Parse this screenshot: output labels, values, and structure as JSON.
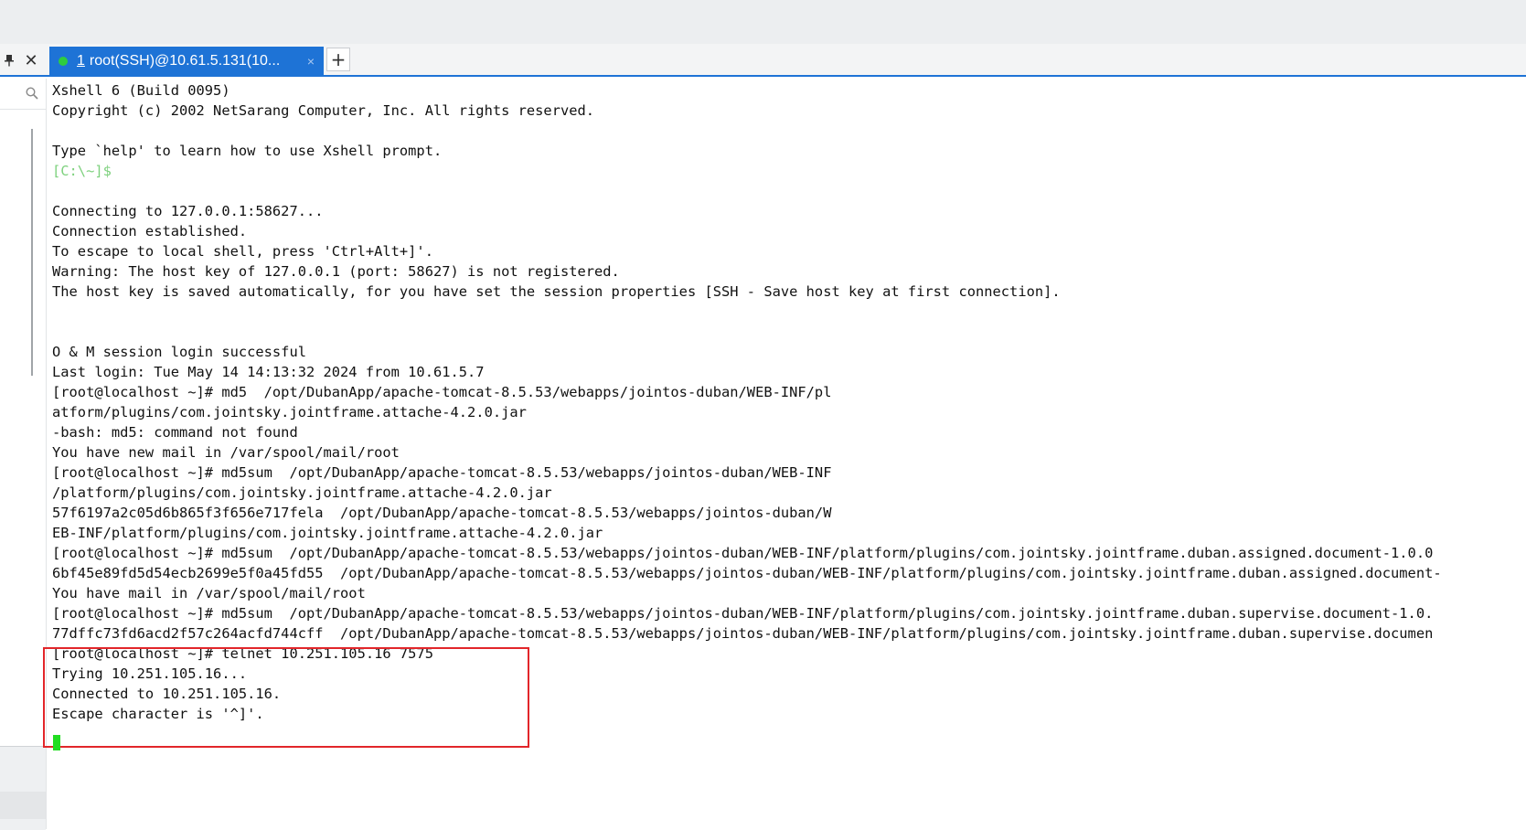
{
  "tabs": {
    "active": {
      "number": "1",
      "title": "root(SSH)@10.61.5.131(10...",
      "close_glyph": "×"
    },
    "new_tab_glyph": "+",
    "pin_glyph": "📌",
    "close_panel_glyph": "✕"
  },
  "terminal": {
    "lines": [
      {
        "text": "Xshell 6 (Build 0095)"
      },
      {
        "text": "Copyright (c) 2002 NetSarang Computer, Inc. All rights reserved."
      },
      {
        "text": ""
      },
      {
        "text": "Type `help' to learn how to use Xshell prompt."
      },
      {
        "text": "[C:\\~]$",
        "style": "local-prompt"
      },
      {
        "text": ""
      },
      {
        "text": "Connecting to 127.0.0.1:58627..."
      },
      {
        "text": "Connection established."
      },
      {
        "text": "To escape to local shell, press 'Ctrl+Alt+]'."
      },
      {
        "text": "Warning: The host key of 127.0.0.1 (port: 58627) is not registered."
      },
      {
        "text": "The host key is saved automatically, for you have set the session properties [SSH - Save host key at first connection]."
      },
      {
        "text": ""
      },
      {
        "text": ""
      },
      {
        "text": "O & M session login successful"
      },
      {
        "text": "Last login: Tue May 14 14:13:32 2024 from 10.61.5.7"
      },
      {
        "text": "[root@localhost ~]# md5  /opt/DubanApp/apache-tomcat-8.5.53/webapps/jointos-duban/WEB-INF/pl"
      },
      {
        "text": "atform/plugins/com.jointsky.jointframe.attache-4.2.0.jar"
      },
      {
        "text": "-bash: md5: command not found"
      },
      {
        "text": "You have new mail in /var/spool/mail/root"
      },
      {
        "text": "[root@localhost ~]# md5sum  /opt/DubanApp/apache-tomcat-8.5.53/webapps/jointos-duban/WEB-INF"
      },
      {
        "text": "/platform/plugins/com.jointsky.jointframe.attache-4.2.0.jar"
      },
      {
        "text": "57f6197a2c05d6b865f3f656e717fela  /opt/DubanApp/apache-tomcat-8.5.53/webapps/jointos-duban/W"
      },
      {
        "text": "EB-INF/platform/plugins/com.jointsky.jointframe.attache-4.2.0.jar"
      },
      {
        "text": "[root@localhost ~]# md5sum  /opt/DubanApp/apache-tomcat-8.5.53/webapps/jointos-duban/WEB-INF/platform/plugins/com.jointsky.jointframe.duban.assigned.document-1.0.0"
      },
      {
        "text": "6bf45e89fd5d54ecb2699e5f0a45fd55  /opt/DubanApp/apache-tomcat-8.5.53/webapps/jointos-duban/WEB-INF/platform/plugins/com.jointsky.jointframe.duban.assigned.document-"
      },
      {
        "text": "You have mail in /var/spool/mail/root"
      },
      {
        "text": "[root@localhost ~]# md5sum  /opt/DubanApp/apache-tomcat-8.5.53/webapps/jointos-duban/WEB-INF/platform/plugins/com.jointsky.jointframe.duban.supervise.document-1.0."
      },
      {
        "text": "77dffc73fd6acd2f57c264acfd744cff  /opt/DubanApp/apache-tomcat-8.5.53/webapps/jointos-duban/WEB-INF/platform/plugins/com.jointsky.jointframe.duban.supervise.documen"
      },
      {
        "text": "[root@localhost ~]# telnet 10.251.105.16 7575"
      },
      {
        "text": "Trying 10.251.105.16..."
      },
      {
        "text": "Connected to 10.251.105.16."
      },
      {
        "text": "Escape character is '^]'."
      }
    ]
  },
  "colors": {
    "tab_active": "#1e73d6",
    "session_status": "#2ecc40",
    "highlight_border": "#e2262a",
    "cursor": "#22dd22"
  },
  "icons": {
    "pin": "pin-icon",
    "close": "close-icon",
    "search": "search-icon",
    "status": "connection-status-icon"
  }
}
